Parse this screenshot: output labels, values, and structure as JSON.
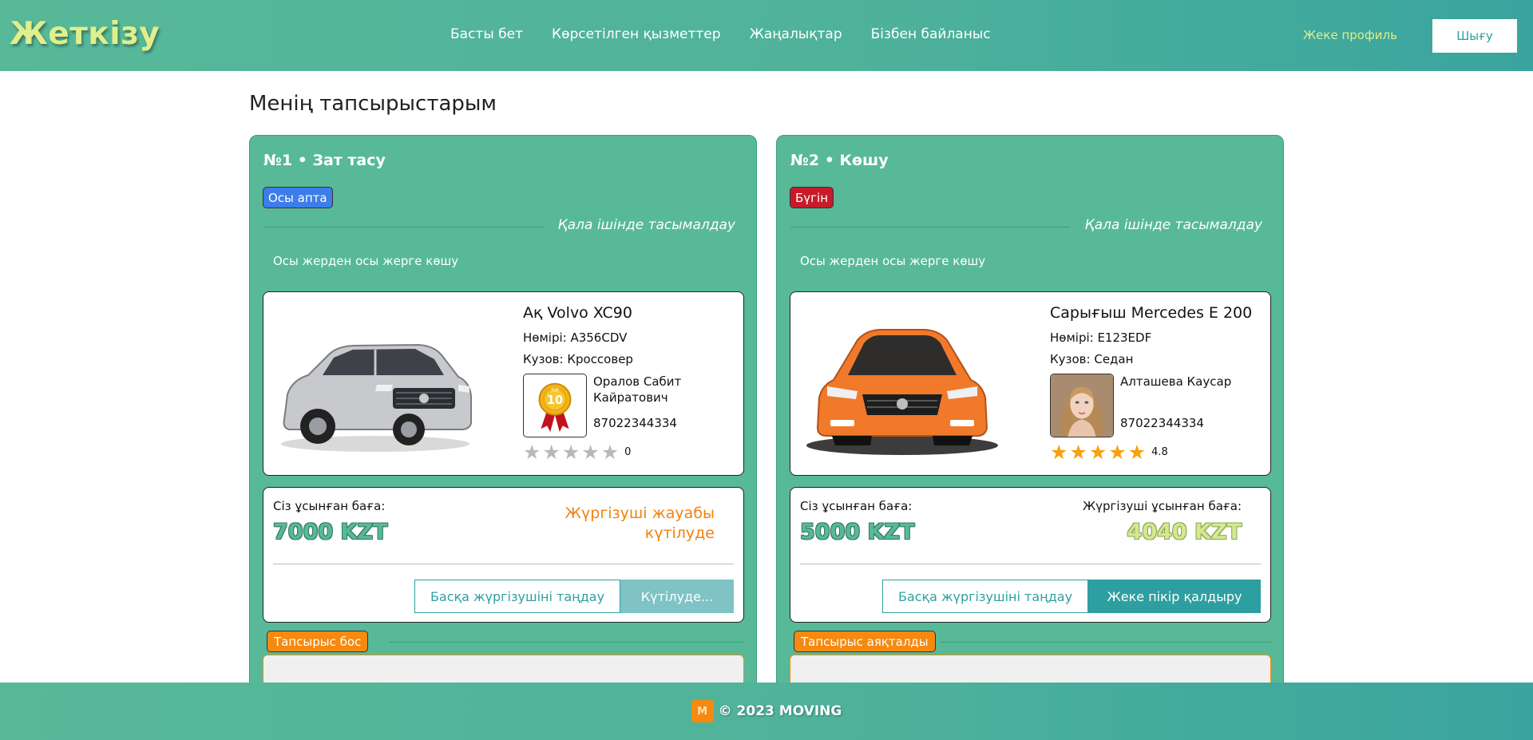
{
  "brand": {
    "logo_text": "Жеткізу"
  },
  "nav": {
    "items": [
      {
        "label": "Басты бет"
      },
      {
        "label": "Көрсетілген қызметтер"
      },
      {
        "label": "Жаңалықтар"
      },
      {
        "label": "Бізбен байланыс"
      }
    ],
    "profile_label": "Жеке профиль",
    "logout_label": "Шығу"
  },
  "page": {
    "title": "Менің тапсырыстарым"
  },
  "orders": [
    {
      "title": "№1 • Зат тасу",
      "badge": "Осы апта",
      "category": "Қала ішінде тасымалдау",
      "route": "Осы жерден осы жерге көшу",
      "car": {
        "name": "Ақ Volvo XC90",
        "number": "Нөмірі: A356CDV",
        "body": "Кузов: Кроссовер"
      },
      "driver": {
        "name": "Оралов Сабит Кайратович",
        "phone": "87022344334",
        "rating": 0,
        "rating_label": "0",
        "photo": "top-10-medal-icon"
      },
      "prices": {
        "your_label": "Сіз ұсынған баға:",
        "your_value": "7000 KZT",
        "wait_text": "Жүргізуші жауабы күтілуде"
      },
      "buttons": {
        "other_driver": "Басқа жүргізушіні таңдау",
        "right": "Күтілуде..."
      },
      "status": "Тапсырыс бос"
    },
    {
      "title": "№2 • Көшу",
      "badge": "Бүгін",
      "category": "Қала ішінде тасымалдау",
      "route": "Осы жерден осы жерге көшу",
      "car": {
        "name": "Сарығыш Mercedes E 200",
        "number": "Нөмірі: E123EDF",
        "body": "Кузов: Седан"
      },
      "driver": {
        "name": "Алташева Каусар",
        "phone": "87022344334",
        "rating": 4.8,
        "rating_label": "4.8",
        "photo": "driver-avatar"
      },
      "prices": {
        "your_label": "Сіз ұсынған баға:",
        "your_value": "5000 KZT",
        "driver_label": "Жүргізуші ұсынған баға:",
        "driver_value": "4040 KZT"
      },
      "buttons": {
        "other_driver": "Басқа жүргізушіні таңдау",
        "right": "Жеке пікір қалдыру"
      },
      "status": "Тапсырыс аяқталды"
    }
  ],
  "footer": {
    "logo_text": "M",
    "copyright": "© 2023 MOVING"
  },
  "colors": {
    "header_green": "#57b998",
    "accent_teal": "#2e9fa0",
    "orange": "#f6890f",
    "logo_yellow": "#e0ef8b"
  }
}
